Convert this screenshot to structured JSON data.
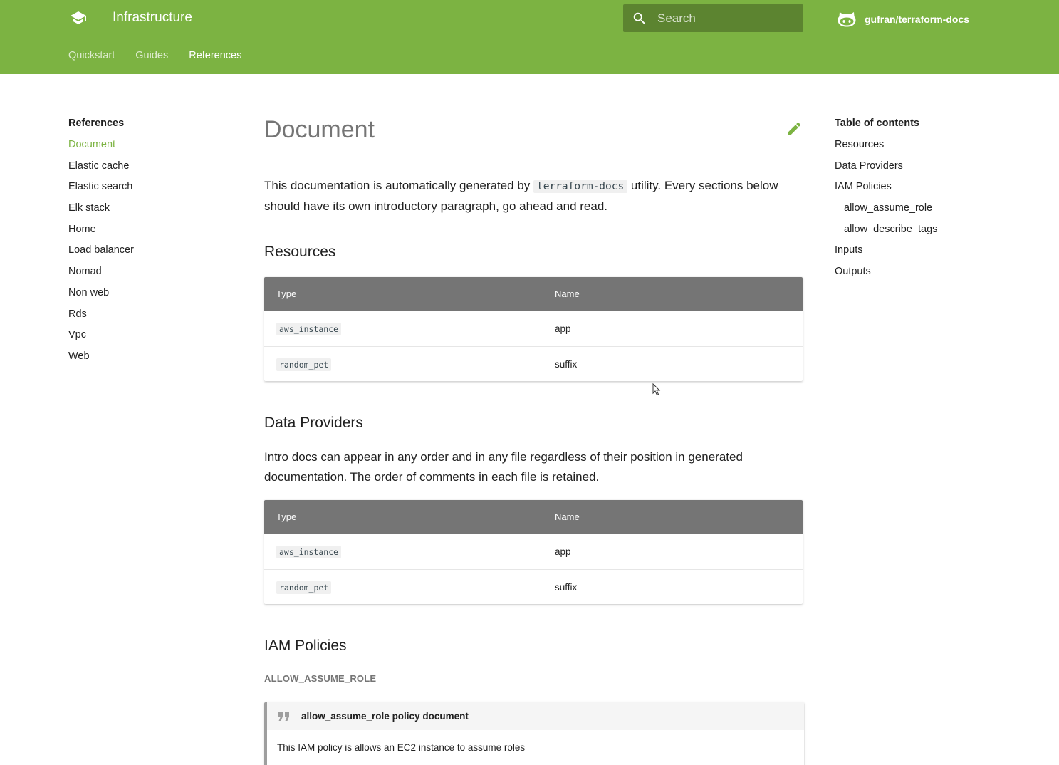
{
  "header": {
    "title": "Infrastructure",
    "search_placeholder": "Search",
    "repo": "gufran/terraform-docs",
    "tabs": [
      {
        "label": "Quickstart"
      },
      {
        "label": "Guides"
      },
      {
        "label": "References"
      }
    ],
    "active_tab": "References"
  },
  "left_nav": {
    "title": "References",
    "items": [
      {
        "label": "Document"
      },
      {
        "label": "Elastic cache"
      },
      {
        "label": "Elastic search"
      },
      {
        "label": "Elk stack"
      },
      {
        "label": "Home"
      },
      {
        "label": "Load balancer"
      },
      {
        "label": "Nomad"
      },
      {
        "label": "Non web"
      },
      {
        "label": "Rds"
      },
      {
        "label": "Vpc"
      },
      {
        "label": "Web"
      }
    ],
    "active_item": "Document"
  },
  "toc": {
    "title": "Table of contents",
    "items": [
      {
        "label": "Resources"
      },
      {
        "label": "Data Providers"
      },
      {
        "label": "IAM Policies"
      },
      {
        "label": "allow_assume_role"
      },
      {
        "label": "allow_describe_tags"
      },
      {
        "label": "Inputs"
      },
      {
        "label": "Outputs"
      }
    ]
  },
  "main": {
    "title": "Document",
    "intro": {
      "before": "This documentation is automatically generated by ",
      "code": "terraform-docs",
      "after": " utility. Every sections below should have its own introductory paragraph, go ahead and read."
    },
    "resources": {
      "heading": "Resources",
      "headers": [
        "Type",
        "Name"
      ],
      "rows": [
        {
          "type": "aws_instance",
          "name": "app"
        },
        {
          "type": "random_pet",
          "name": "suffix"
        }
      ]
    },
    "data_providers": {
      "heading": "Data Providers",
      "intro": "Intro docs can appear in any order and in any file regardless of their position in generated documentation. The order of comments in each file is retained.",
      "headers": [
        "Type",
        "Name"
      ],
      "rows": [
        {
          "type": "aws_instance",
          "name": "app"
        },
        {
          "type": "random_pet",
          "name": "suffix"
        }
      ]
    },
    "iam": {
      "heading": "IAM Policies",
      "subheading": "ALLOW_ASSUME_ROLE",
      "admonition_title": "allow_assume_role policy document",
      "admonition_body": "This IAM policy is allows an EC2 instance to assume roles"
    }
  },
  "colors": {
    "primary": "#7cb342",
    "table_header": "#757575"
  },
  "icons": {
    "logo": "school-icon",
    "search": "search-icon",
    "repo": "github-icon",
    "edit": "pencil-icon",
    "quote": "quote-icon"
  }
}
